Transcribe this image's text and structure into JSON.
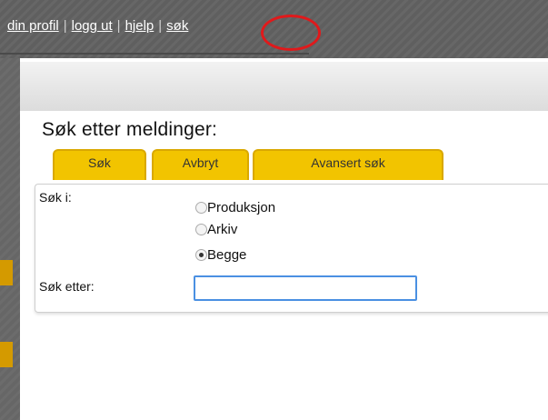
{
  "nav": {
    "profile": "din profil",
    "logout": "logg ut",
    "help": "hjelp",
    "search": "søk",
    "separator": "|"
  },
  "page_title": "Søk etter meldinger:",
  "tabs": [
    "Søk",
    "Avbryt",
    "Avansert søk"
  ],
  "form": {
    "search_in_label": "Søk i:",
    "options": [
      {
        "label": "Produksjon",
        "checked": false
      },
      {
        "label": "Arkiv",
        "checked": false
      },
      {
        "label": "Begge",
        "checked": true
      }
    ],
    "search_for_label": "Søk etter:",
    "search_value": ""
  },
  "colors": {
    "topbar": "#5f5f5f",
    "tab": "#f2c400",
    "annotation": "#e0191b",
    "input_focus": "#4a90e2"
  }
}
